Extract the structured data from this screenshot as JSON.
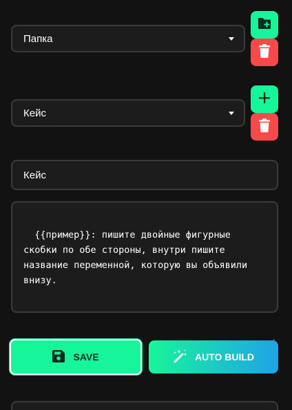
{
  "folder_select": {
    "value": "Папка"
  },
  "case_select": {
    "value": "Кейс"
  },
  "name_input": {
    "value": "Кейс"
  },
  "template_text": {
    "value": "{{пример}}: пишите двойные фигурные скобки по обе стороны, внутри пишите название переменной, которую вы объявили внизу."
  },
  "actions": {
    "save_label": "SAVE",
    "auto_build_label": "AUTO BUILD"
  },
  "icons": {
    "add_folder": "folder-plus-icon",
    "delete": "trash-icon",
    "add": "plus-icon",
    "save": "floppy-disk-icon",
    "auto_build": "magic-wand-icon"
  },
  "colors": {
    "accent_green": "#17f59a",
    "danger_red": "#f94848",
    "gradient_end_blue": "#1fa3e6",
    "background": "#121212"
  }
}
